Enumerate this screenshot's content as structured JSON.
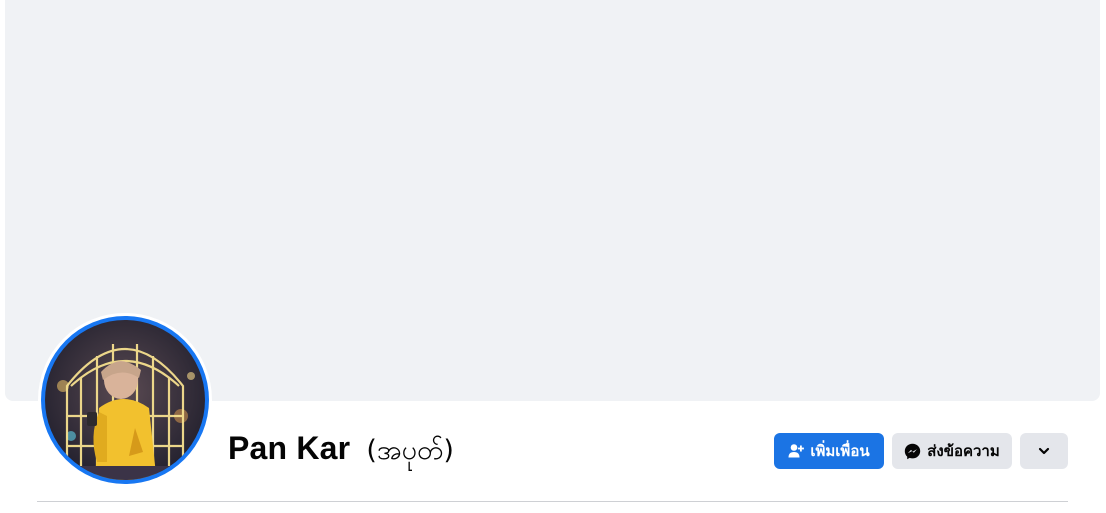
{
  "profile": {
    "name": "Pan Kar",
    "alternate_name": "(အပုတ်)"
  },
  "actions": {
    "add_friend_label": "เพิ่มเพื่อน",
    "message_label": "ส่งข้อความ",
    "more_icon": "chevron-down-icon"
  },
  "icons": {
    "add_friend": "person-add-icon",
    "message": "messenger-icon"
  },
  "colors": {
    "cover_bg": "#f0f2f5",
    "primary_button": "#1b74e4",
    "secondary_button": "#e4e6eb",
    "avatar_ring": "#1877f2"
  }
}
